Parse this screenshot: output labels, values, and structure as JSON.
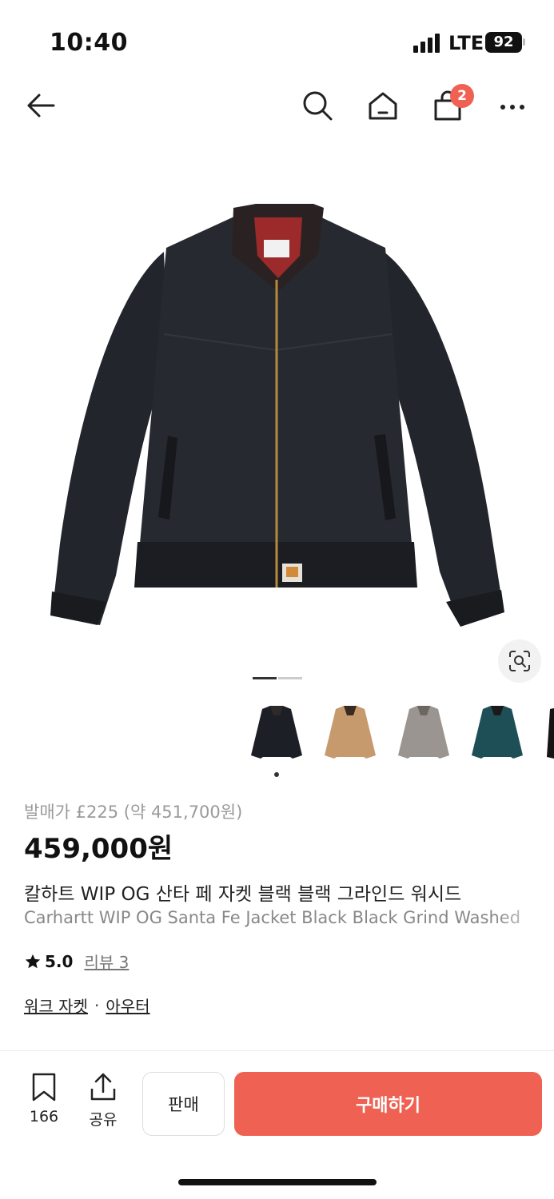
{
  "status": {
    "time": "10:40",
    "network": "LTE",
    "battery": "92"
  },
  "nav": {
    "cart_count": "2"
  },
  "gallery": {
    "thumb_colors": [
      "#1d1f26",
      "#c79a6e",
      "#9a9590",
      "#1e4f57"
    ]
  },
  "product": {
    "release_price": "발매가 £225 (약 451,700원)",
    "price": "459,000원",
    "title_ko": "칼하트 WIP OG 산타 페 자켓 블랙 블랙 그라인드 워시드",
    "title_en": "Carhartt WIP OG Santa Fe Jacket Black Black Grind Washed",
    "rating": "5.0",
    "review_label": "리뷰 3",
    "categories": [
      "워크 자켓",
      "아우터"
    ]
  },
  "bottom_bar": {
    "bookmark_count": "166",
    "share_label": "공유",
    "sell_label": "판매",
    "buy_label": "구매하기"
  },
  "colors": {
    "accent": "#ef6253"
  }
}
